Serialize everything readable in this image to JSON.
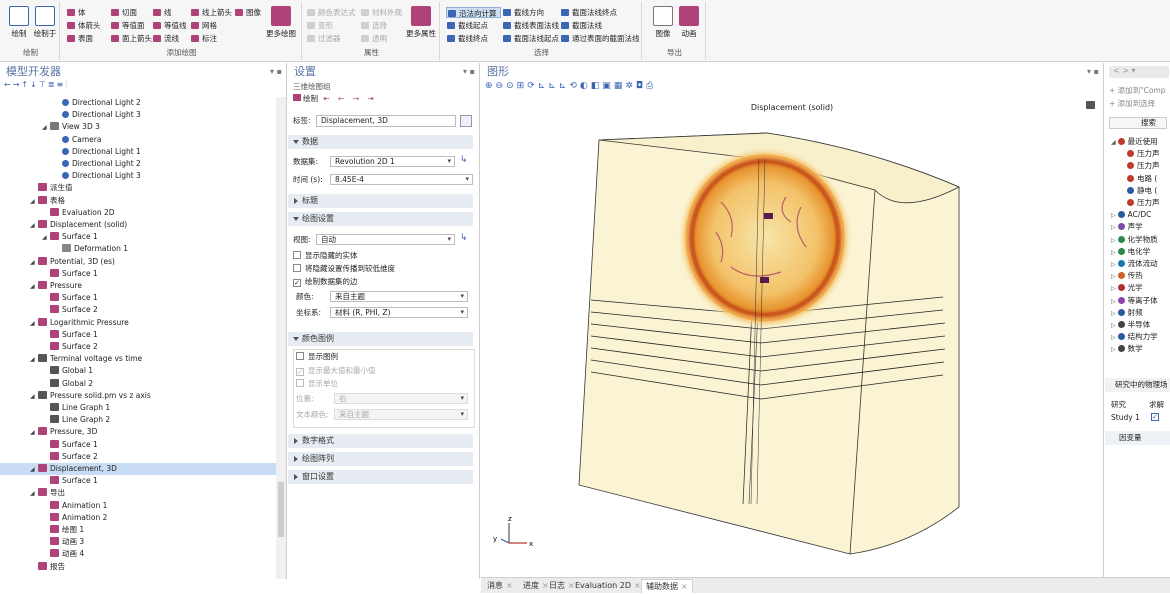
{
  "ribbon": {
    "groups": [
      {
        "label": "绘制",
        "buttons": [
          "绘制",
          "绘制于"
        ]
      },
      {
        "label": "添加绘图",
        "small": [
          "体",
          "切面",
          "线",
          "线上箭头",
          "图像",
          "体箭头",
          "等值面",
          "等值线",
          "网格",
          "表面",
          "面上箭头",
          "流线",
          "标注"
        ],
        "big": "更多绘图"
      },
      {
        "label": "属性",
        "small": [
          "颜色表达式",
          "材料外观",
          "变形",
          "选择",
          "过滤器",
          "透明"
        ],
        "big": "更多属性"
      },
      {
        "label": "选择",
        "small": [
          "沿法向计算",
          "截线方向",
          "截面法线终点",
          "截线起点",
          "截线表面法线",
          "截面法线",
          "截线终点",
          "截面法线起点",
          "通过表面的截面法线"
        ]
      },
      {
        "label": "导出",
        "buttons": [
          "图像",
          "动画"
        ]
      }
    ]
  },
  "model_builder": {
    "title": "模型开发器",
    "toolbar_icons": [
      "arrow-left-icon",
      "arrow-right-icon",
      "arrow-up-icon",
      "arrow-down-icon",
      "filter-icon",
      "expand-icon",
      "collapse-icon",
      "menu-icon"
    ],
    "tree": [
      {
        "label": "Directional Light 2",
        "depth": 5,
        "icon": "light"
      },
      {
        "label": "Directional Light 3",
        "depth": 5,
        "icon": "light"
      },
      {
        "label": "View 3D 3",
        "depth": 4,
        "icon": "view",
        "expanded": true
      },
      {
        "label": "Camera",
        "depth": 5,
        "icon": "light"
      },
      {
        "label": "Directional Light 1",
        "depth": 5,
        "icon": "light"
      },
      {
        "label": "Directional Light 2",
        "depth": 5,
        "icon": "light"
      },
      {
        "label": "Directional Light 3",
        "depth": 5,
        "icon": "light"
      },
      {
        "label": "派生值",
        "depth": 3,
        "icon": "derived"
      },
      {
        "label": "表格",
        "depth": 3,
        "icon": "table",
        "expanded": true
      },
      {
        "label": "Evaluation 2D",
        "depth": 4,
        "icon": "table"
      },
      {
        "label": "Displacement (solid)",
        "depth": 3,
        "icon": "plot",
        "expanded": true
      },
      {
        "label": "Surface 1",
        "depth": 4,
        "icon": "plot",
        "expanded": true
      },
      {
        "label": "Deformation 1",
        "depth": 5,
        "icon": "deform"
      },
      {
        "label": "Potential, 3D (es)",
        "depth": 3,
        "icon": "plot",
        "expanded": true
      },
      {
        "label": "Surface 1",
        "depth": 4,
        "icon": "plot"
      },
      {
        "label": "Pressure",
        "depth": 3,
        "icon": "plot",
        "expanded": true
      },
      {
        "label": "Surface 1",
        "depth": 4,
        "icon": "plot"
      },
      {
        "label": "Surface 2",
        "depth": 4,
        "icon": "plot"
      },
      {
        "label": "Logarithmic Pressure",
        "depth": 3,
        "icon": "plot",
        "expanded": true
      },
      {
        "label": "Surface 1",
        "depth": 4,
        "icon": "plot"
      },
      {
        "label": "Surface 2",
        "depth": 4,
        "icon": "plot"
      },
      {
        "label": "Terminal voltage vs time",
        "depth": 3,
        "icon": "line",
        "expanded": true
      },
      {
        "label": "Global 1",
        "depth": 4,
        "icon": "global"
      },
      {
        "label": "Global 2",
        "depth": 4,
        "icon": "global"
      },
      {
        "label": "Pressure solid.pm vs z axis",
        "depth": 3,
        "icon": "line",
        "expanded": true
      },
      {
        "label": "Line Graph 1",
        "depth": 4,
        "icon": "line"
      },
      {
        "label": "Line Graph 2",
        "depth": 4,
        "icon": "line"
      },
      {
        "label": "Pressure, 3D",
        "depth": 3,
        "icon": "plot3d",
        "expanded": true
      },
      {
        "label": "Surface 1",
        "depth": 4,
        "icon": "plot"
      },
      {
        "label": "Surface 2",
        "depth": 4,
        "icon": "plot"
      },
      {
        "label": "Displacement, 3D",
        "depth": 3,
        "icon": "plot3d",
        "expanded": true,
        "selected": true
      },
      {
        "label": "Surface 1",
        "depth": 4,
        "icon": "plot"
      },
      {
        "label": "导出",
        "depth": 3,
        "icon": "export",
        "expanded": true
      },
      {
        "label": "Animation 1",
        "depth": 4,
        "icon": "anim"
      },
      {
        "label": "Animation 2",
        "depth": 4,
        "icon": "anim"
      },
      {
        "label": "绘图 1",
        "depth": 4,
        "icon": "anim"
      },
      {
        "label": "动画 3",
        "depth": 4,
        "icon": "anim"
      },
      {
        "label": "动画 4",
        "depth": 4,
        "icon": "anim"
      },
      {
        "label": "报告",
        "depth": 3,
        "icon": "report"
      }
    ]
  },
  "settings": {
    "title": "设置",
    "subtitle": "三维绘图组",
    "plot_label": "绘制",
    "label_caption": "标签:",
    "label_value": "Displacement, 3D",
    "sections": {
      "data": "数据",
      "title": "标题",
      "plot_settings": "绘图设置",
      "color_legend": "颜色图例",
      "number_format": "数字格式",
      "plot_array": "绘图阵列",
      "window_settings": "窗口设置"
    },
    "dataset_caption": "数据集:",
    "dataset_value": "Revolution 2D 1",
    "time_caption": "时间 (s):",
    "time_value": "8.45E-4",
    "view_caption": "视图:",
    "view_value": "自动",
    "cb_hidden": "显示隐藏的实体",
    "cb_propagate": "将隐藏设置传播到较低维度",
    "cb_edges": "绘制数据集的边",
    "color_caption": "颜色:",
    "color_value": "来自主题",
    "coord_caption": "坐标系:",
    "coord_value": "材料 (R, PHI, Z)",
    "cb_show_legend": "显示图例",
    "cb_show_maxmin": "显示最大值和最小值",
    "cb_show_units": "显示单位",
    "position_caption": "位置:",
    "position_value": "右",
    "text_color_caption": "文本颜色:",
    "text_color_value": "来自主题"
  },
  "graphics": {
    "title": "图形",
    "plot_title": "Displacement (solid)",
    "axes": {
      "x": "x",
      "y": "y",
      "z": "z"
    }
  },
  "right_panel": {
    "add_to": "添加到\"Comp",
    "add_selection": "添加到选择",
    "search": "搜索",
    "tree": [
      {
        "label": "最近使用",
        "expanded": true,
        "color": "#c0392b"
      },
      {
        "label": "压力声",
        "sub": true,
        "color": "#c0392b"
      },
      {
        "label": "压力声",
        "sub": true,
        "color": "#c0392b"
      },
      {
        "label": "电路 (",
        "sub": true,
        "color": "#c0392b"
      },
      {
        "label": "静电 (",
        "sub": true,
        "color": "#2c5aa0"
      },
      {
        "label": "压力声",
        "sub": true,
        "color": "#c0392b"
      },
      {
        "label": "AC/DC",
        "color": "#2c5aa0"
      },
      {
        "label": "声学",
        "color": "#7a4ea8"
      },
      {
        "label": "化学物质",
        "color": "#2c8a4a"
      },
      {
        "label": "电化学",
        "color": "#2c8a4a"
      },
      {
        "label": "流体流动",
        "color": "#1a7ab0"
      },
      {
        "label": "传热",
        "color": "#d0602a"
      },
      {
        "label": "光学",
        "color": "#b03030"
      },
      {
        "label": "等离子体",
        "color": "#8e44ad"
      },
      {
        "label": "射频",
        "color": "#2c5aa0"
      },
      {
        "label": "半导体",
        "color": "#444444"
      },
      {
        "label": "结构力学",
        "color": "#2c5aa0"
      },
      {
        "label": "数学",
        "color": "#444444"
      }
    ],
    "studies_caption": "研究中的物理场",
    "col_study": "研究",
    "col_solve": "求解",
    "study_row": "Study 1",
    "dependent_vars": "因变量"
  },
  "bottom_tabs": [
    "消息",
    "进度",
    "日志",
    "Evaluation 2D",
    "辅助数据"
  ],
  "colors": {
    "accent": "#3b65b5",
    "panel_title": "#5b73a4",
    "selected": "#c8dcf4",
    "plot_icon": "#b0427a",
    "model_body": "#fbf4d4"
  }
}
